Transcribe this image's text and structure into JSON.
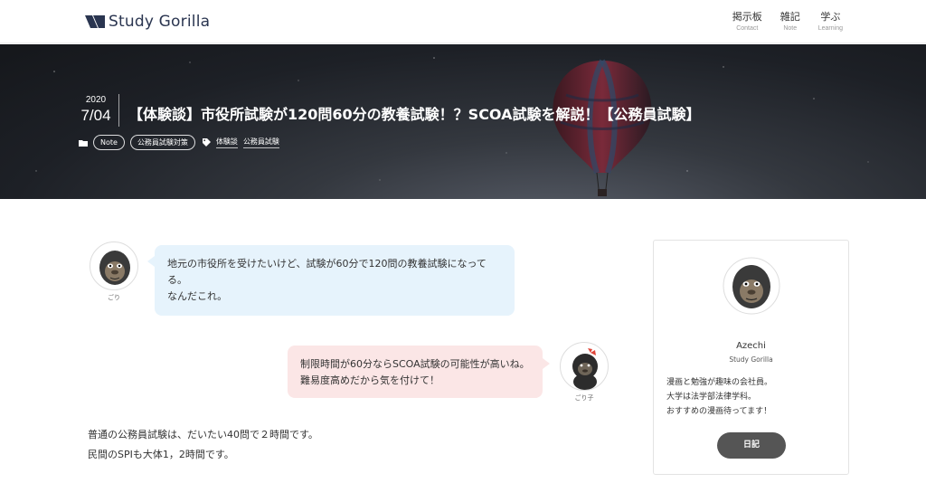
{
  "header": {
    "logo_text": "Study Gorilla",
    "nav": [
      {
        "label": "掲示板",
        "sub": "Contact"
      },
      {
        "label": "雑記",
        "sub": "Note"
      },
      {
        "label": "学ぶ",
        "sub": "Learning"
      }
    ]
  },
  "hero": {
    "date_year": "2020",
    "date_md": "7/04",
    "title": "【体験談】市役所試験が120問60分の教養試験！？SCOA試験を解説！【公務員試験】",
    "categories": [
      "Note",
      "公務員試験対策"
    ],
    "tags": [
      "体験談",
      "公務員試験"
    ]
  },
  "chat": {
    "left": {
      "name": "ごり",
      "lines": [
        "地元の市役所を受けたいけど、試験が60分で120問の教養試験になってる。",
        "なんだこれ。"
      ]
    },
    "right": {
      "name": "ごり子",
      "lines": [
        "制限時間が60分ならSCOA試験の可能性が高いね。",
        "難易度高めだから気を付けて！"
      ]
    }
  },
  "body": {
    "lines": [
      "普通の公務員試験は、だいたい40問で２時間です。",
      "民間のSPIも大体1，2時間です。"
    ]
  },
  "sidebar": {
    "name": "Azechi",
    "site": "Study Gorilla",
    "bio": [
      "漫画と勉強が趣味の会社員。",
      "大学は法学部法律学科。",
      "おすすめの漫画待ってます！"
    ],
    "button": "日記"
  },
  "icons": {
    "logo": "logo-mark-icon",
    "folder": "folder-icon",
    "tag": "tag-icon",
    "balloon": "hot-air-balloon-image"
  }
}
